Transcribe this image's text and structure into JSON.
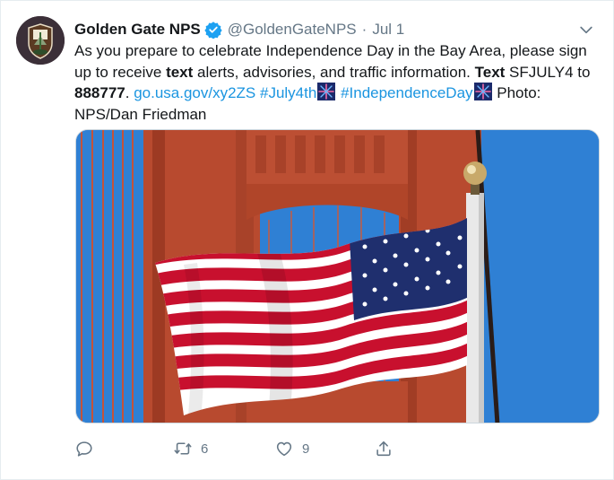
{
  "tweet": {
    "author_name": "Golden Gate NPS",
    "handle": "@GoldenGateNPS",
    "separator": "·",
    "date": "Jul 1",
    "text": {
      "p1": "As you prepare to celebrate Independence Day in the Bay Area, please sign up to receive ",
      "b1": "text",
      "p2": " alerts, advisories, and traffic information. ",
      "b2": "Text",
      "p3": " SFJULY4 to ",
      "b3": "888777",
      "p4": ". ",
      "link": "go.usa.gov/xy2ZS",
      "hashtag1": "#July4th",
      "hashtag2": "#IndependenceDay",
      "credit": " Photo: NPS/Dan Friedman"
    },
    "media_alt": "American flag waving in front of the Golden Gate Bridge tower",
    "actions": {
      "reply_count": "",
      "retweet_count": "6",
      "like_count": "9"
    }
  },
  "colors": {
    "link": "#1b95e0",
    "muted": "#657786",
    "verified": "#1da1f2"
  },
  "icons": [
    "nps-logo-icon",
    "verified-badge-icon",
    "chevron-down-icon",
    "fireworks-icon",
    "reply-icon",
    "retweet-icon",
    "like-icon",
    "share-icon"
  ]
}
